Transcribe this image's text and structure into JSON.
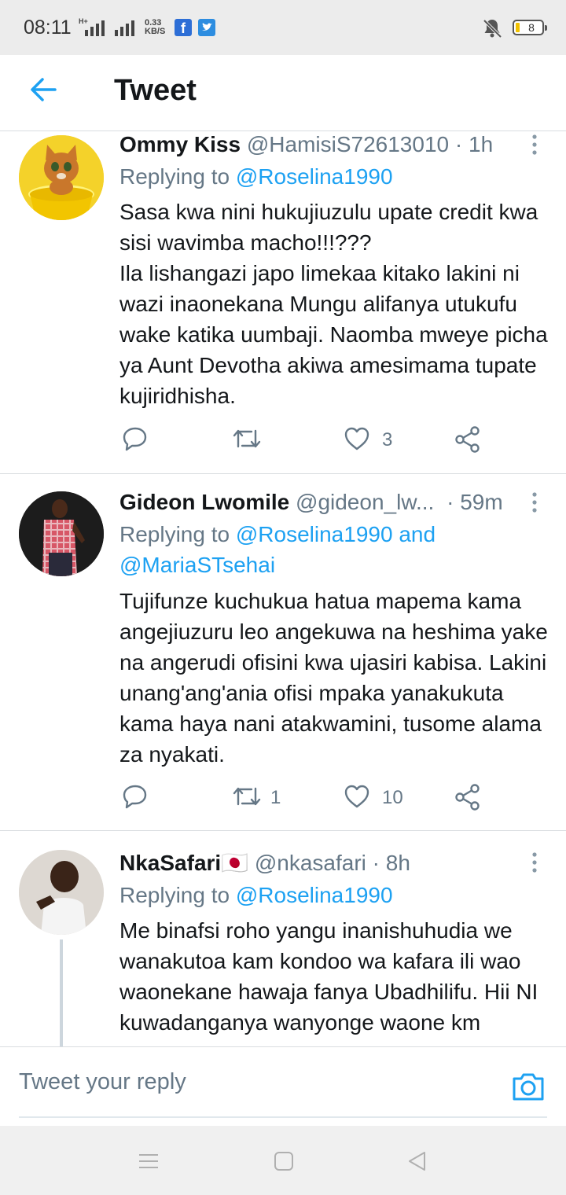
{
  "status_bar": {
    "time": "08:11",
    "net_speed_value": "0.33",
    "net_speed_unit": "KB/S",
    "battery_level": "8",
    "network_type": "H+"
  },
  "header": {
    "title": "Tweet"
  },
  "tweets": [
    {
      "name": "Ommy Kiss",
      "handle": "@HamisiS72613010",
      "time": "· 1h",
      "replying_prefix": "Replying to ",
      "replying_to": "@Roselina1990",
      "replying_to_extra": "",
      "body": "Sasa kwa  nini hukujiuzulu upate credit kwa sisi wavimba macho!!!???\nIla lishangazi japo limekaa kitako lakini ni wazi inaonekana Mungu alifanya utukufu wake katika uumbaji. Naomba mweye picha ya Aunt Devotha akiwa amesimama tupate kujiridhisha.",
      "reply_count": "",
      "retweet_count": "",
      "like_count": "3"
    },
    {
      "name": "Gideon Lwomile",
      "handle": "@gideon_lw...",
      "time": "· 59m",
      "replying_prefix": "Replying to ",
      "replying_to": "@Roselina1990",
      "replying_and": " and",
      "replying_to_extra": "@MariaSTsehai",
      "body": "Tujifunze kuchukua hatua mapema kama angejiuzuru leo angekuwa na heshima yake na angerudi ofisini kwa ujasiri kabisa. Lakini unang'ang'ania ofisi mpaka yanakukuta kama haya nani atakwamini, tusome alama za nyakati.",
      "reply_count": "",
      "retweet_count": "1",
      "like_count": "10"
    },
    {
      "name": "NkaSafari",
      "flag": "🇯🇵",
      "handle": "@nkasafari",
      "time": "· 8h",
      "replying_prefix": "Replying to ",
      "replying_to": "@Roselina1990",
      "replying_to_extra": "",
      "body": "Me binafsi roho yangu inanishuhudia we wanakutoa kam kondoo wa kafara ili wao waonekane hawaja fanya Ubadhilifu. Hii NI kuwadanganya wanyonge waone km"
    }
  ],
  "reply_bar": {
    "placeholder": "Tweet your reply"
  },
  "colors": {
    "accent": "#1da1f2",
    "secondary_text": "#657786",
    "text": "#14171a"
  },
  "icons": [
    "back-arrow-icon",
    "more-vertical-icon",
    "reply-icon",
    "retweet-icon",
    "like-icon",
    "share-icon",
    "camera-icon",
    "menu-icon",
    "home-square-icon",
    "back-triangle-icon"
  ]
}
